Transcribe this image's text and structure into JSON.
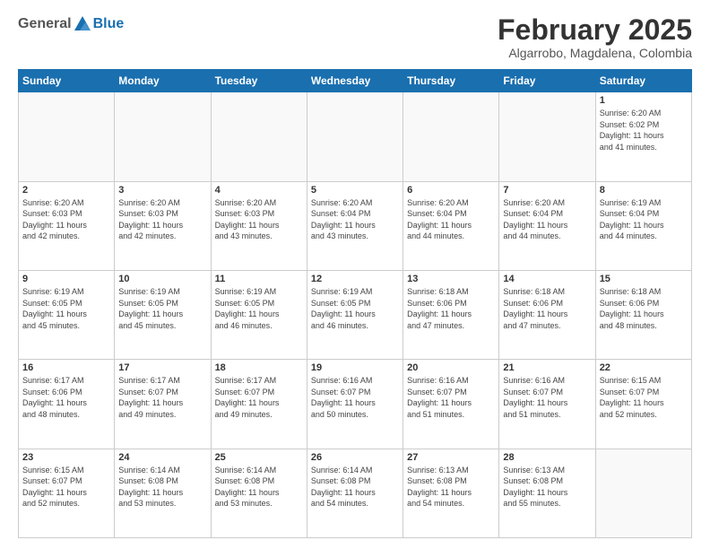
{
  "header": {
    "logo_general": "General",
    "logo_blue": "Blue",
    "cal_title": "February 2025",
    "cal_subtitle": "Algarrobo, Magdalena, Colombia"
  },
  "days_of_week": [
    "Sunday",
    "Monday",
    "Tuesday",
    "Wednesday",
    "Thursday",
    "Friday",
    "Saturday"
  ],
  "weeks": [
    [
      {
        "day": "",
        "info": ""
      },
      {
        "day": "",
        "info": ""
      },
      {
        "day": "",
        "info": ""
      },
      {
        "day": "",
        "info": ""
      },
      {
        "day": "",
        "info": ""
      },
      {
        "day": "",
        "info": ""
      },
      {
        "day": "1",
        "info": "Sunrise: 6:20 AM\nSunset: 6:02 PM\nDaylight: 11 hours\nand 41 minutes."
      }
    ],
    [
      {
        "day": "2",
        "info": "Sunrise: 6:20 AM\nSunset: 6:03 PM\nDaylight: 11 hours\nand 42 minutes."
      },
      {
        "day": "3",
        "info": "Sunrise: 6:20 AM\nSunset: 6:03 PM\nDaylight: 11 hours\nand 42 minutes."
      },
      {
        "day": "4",
        "info": "Sunrise: 6:20 AM\nSunset: 6:03 PM\nDaylight: 11 hours\nand 43 minutes."
      },
      {
        "day": "5",
        "info": "Sunrise: 6:20 AM\nSunset: 6:04 PM\nDaylight: 11 hours\nand 43 minutes."
      },
      {
        "day": "6",
        "info": "Sunrise: 6:20 AM\nSunset: 6:04 PM\nDaylight: 11 hours\nand 44 minutes."
      },
      {
        "day": "7",
        "info": "Sunrise: 6:20 AM\nSunset: 6:04 PM\nDaylight: 11 hours\nand 44 minutes."
      },
      {
        "day": "8",
        "info": "Sunrise: 6:19 AM\nSunset: 6:04 PM\nDaylight: 11 hours\nand 44 minutes."
      }
    ],
    [
      {
        "day": "9",
        "info": "Sunrise: 6:19 AM\nSunset: 6:05 PM\nDaylight: 11 hours\nand 45 minutes."
      },
      {
        "day": "10",
        "info": "Sunrise: 6:19 AM\nSunset: 6:05 PM\nDaylight: 11 hours\nand 45 minutes."
      },
      {
        "day": "11",
        "info": "Sunrise: 6:19 AM\nSunset: 6:05 PM\nDaylight: 11 hours\nand 46 minutes."
      },
      {
        "day": "12",
        "info": "Sunrise: 6:19 AM\nSunset: 6:05 PM\nDaylight: 11 hours\nand 46 minutes."
      },
      {
        "day": "13",
        "info": "Sunrise: 6:18 AM\nSunset: 6:06 PM\nDaylight: 11 hours\nand 47 minutes."
      },
      {
        "day": "14",
        "info": "Sunrise: 6:18 AM\nSunset: 6:06 PM\nDaylight: 11 hours\nand 47 minutes."
      },
      {
        "day": "15",
        "info": "Sunrise: 6:18 AM\nSunset: 6:06 PM\nDaylight: 11 hours\nand 48 minutes."
      }
    ],
    [
      {
        "day": "16",
        "info": "Sunrise: 6:17 AM\nSunset: 6:06 PM\nDaylight: 11 hours\nand 48 minutes."
      },
      {
        "day": "17",
        "info": "Sunrise: 6:17 AM\nSunset: 6:07 PM\nDaylight: 11 hours\nand 49 minutes."
      },
      {
        "day": "18",
        "info": "Sunrise: 6:17 AM\nSunset: 6:07 PM\nDaylight: 11 hours\nand 49 minutes."
      },
      {
        "day": "19",
        "info": "Sunrise: 6:16 AM\nSunset: 6:07 PM\nDaylight: 11 hours\nand 50 minutes."
      },
      {
        "day": "20",
        "info": "Sunrise: 6:16 AM\nSunset: 6:07 PM\nDaylight: 11 hours\nand 51 minutes."
      },
      {
        "day": "21",
        "info": "Sunrise: 6:16 AM\nSunset: 6:07 PM\nDaylight: 11 hours\nand 51 minutes."
      },
      {
        "day": "22",
        "info": "Sunrise: 6:15 AM\nSunset: 6:07 PM\nDaylight: 11 hours\nand 52 minutes."
      }
    ],
    [
      {
        "day": "23",
        "info": "Sunrise: 6:15 AM\nSunset: 6:07 PM\nDaylight: 11 hours\nand 52 minutes."
      },
      {
        "day": "24",
        "info": "Sunrise: 6:14 AM\nSunset: 6:08 PM\nDaylight: 11 hours\nand 53 minutes."
      },
      {
        "day": "25",
        "info": "Sunrise: 6:14 AM\nSunset: 6:08 PM\nDaylight: 11 hours\nand 53 minutes."
      },
      {
        "day": "26",
        "info": "Sunrise: 6:14 AM\nSunset: 6:08 PM\nDaylight: 11 hours\nand 54 minutes."
      },
      {
        "day": "27",
        "info": "Sunrise: 6:13 AM\nSunset: 6:08 PM\nDaylight: 11 hours\nand 54 minutes."
      },
      {
        "day": "28",
        "info": "Sunrise: 6:13 AM\nSunset: 6:08 PM\nDaylight: 11 hours\nand 55 minutes."
      },
      {
        "day": "",
        "info": ""
      }
    ]
  ]
}
